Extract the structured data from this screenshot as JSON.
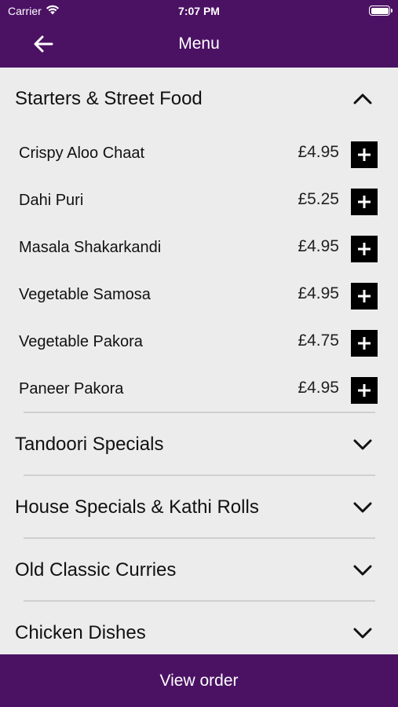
{
  "status_bar": {
    "carrier": "Carrier",
    "time": "7:07 PM",
    "wifi_icon": "wifi-icon",
    "battery_icon": "battery-icon"
  },
  "header": {
    "title": "Menu",
    "back_icon": "arrow-left-icon",
    "background": "#4b1264"
  },
  "categories": [
    {
      "title": "Starters & Street Food",
      "expanded": true,
      "items": [
        {
          "name": "Crispy Aloo Chaat",
          "price": "£4.95"
        },
        {
          "name": "Dahi Puri",
          "price": "£5.25"
        },
        {
          "name": "Masala Shakarkandi",
          "price": "£4.95"
        },
        {
          "name": "Vegetable Samosa",
          "price": "£4.95"
        },
        {
          "name": "Vegetable Pakora",
          "price": "£4.75"
        },
        {
          "name": "Paneer Pakora",
          "price": "£4.95"
        }
      ]
    },
    {
      "title": "Tandoori Specials",
      "expanded": false
    },
    {
      "title": "House Specials & Kathi Rolls",
      "expanded": false
    },
    {
      "title": "Old Classic Curries",
      "expanded": false
    },
    {
      "title": "Chicken Dishes",
      "expanded": false
    }
  ],
  "footer": {
    "button_label": "View order",
    "background": "#4b1264"
  }
}
